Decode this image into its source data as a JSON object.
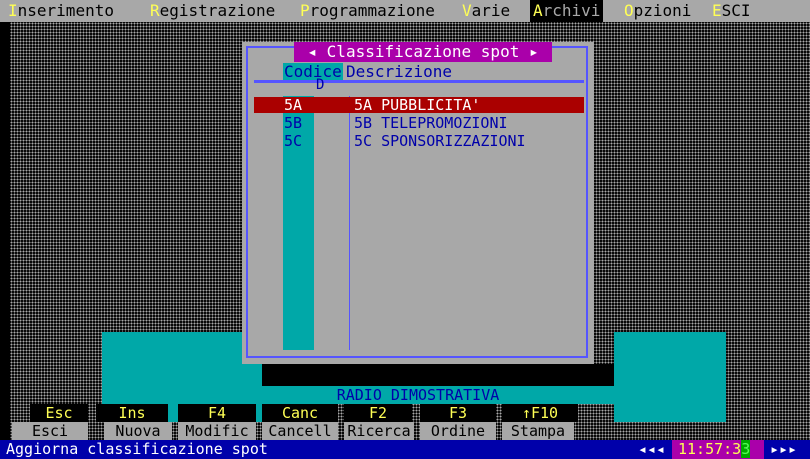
{
  "menu": {
    "items": [
      {
        "hot": "I",
        "rest": "nserimento"
      },
      {
        "hot": "R",
        "rest": "egistrazione"
      },
      {
        "hot": "P",
        "rest": "rogrammazione"
      },
      {
        "hot": "V",
        "rest": "arie"
      },
      {
        "hot": "A",
        "rest": "rchivi"
      },
      {
        "hot": "O",
        "rest": "pzioni"
      },
      {
        "hot": "E",
        "rest": "SCI"
      }
    ],
    "active_index": 4
  },
  "dialog": {
    "title": "◂ Classificazione spot ▸",
    "col_code": "Codice",
    "col_desc": "Descrizione",
    "sort_marker": "D",
    "rows": [
      {
        "code": "5A",
        "desc": "5A PUBBLICITA'",
        "selected": true
      },
      {
        "code": "5B",
        "desc": "5B TELEPROMOZIONI",
        "selected": false
      },
      {
        "code": "5C",
        "desc": "5C SPONSORIZZAZIONI",
        "selected": false
      }
    ]
  },
  "station": "RADIO DIMOSTRATIVA",
  "fkeys": [
    {
      "key": "Esc",
      "label": "Esci"
    },
    {
      "key": "Ins",
      "label": "Nuova"
    },
    {
      "key": "F4",
      "label": "Modific"
    },
    {
      "key": "Canc",
      "label": "Cancell"
    },
    {
      "key": "F2",
      "label": "Ricerca"
    },
    {
      "key": "F3",
      "label": "Ordine"
    },
    {
      "key": "↑F10",
      "label": "Stampa"
    }
  ],
  "status": {
    "text": "Aggiorna classificazione spot",
    "clock_prefix": "◂◂◂",
    "clock": "11:57:3",
    "clock_last": "3",
    "clock_suffix": "▸▸▸"
  }
}
